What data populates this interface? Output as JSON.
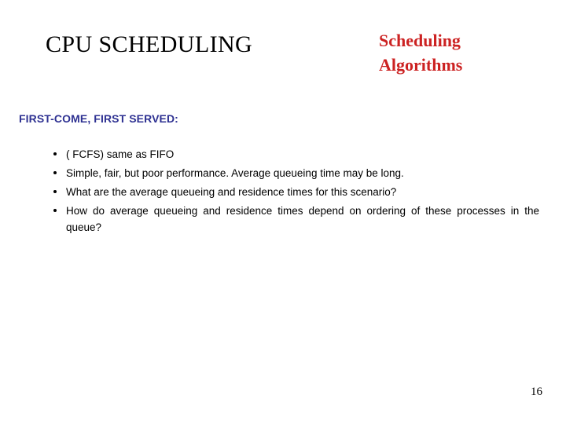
{
  "slide": {
    "title_main": "CPU SCHEDULING",
    "title_red_line1": "Scheduling",
    "title_red_line2": "Algorithms",
    "section_label": "FIRST-COME, FIRST SERVED:",
    "page_number": "16",
    "colors": {
      "title_main": "#000000",
      "title_red": "#CC2222",
      "section_label": "#2E3192",
      "body_text": "#000000",
      "background": "#FFFFFF"
    },
    "bullets": [
      "( FCFS) same as FIFO",
      "Simple, fair, but poor performance.   Average queueing time may be long.",
      "What are the average queueing and residence times for this scenario?",
      "How do average queueing and residence times depend on ordering of these processes in the queue?"
    ]
  }
}
